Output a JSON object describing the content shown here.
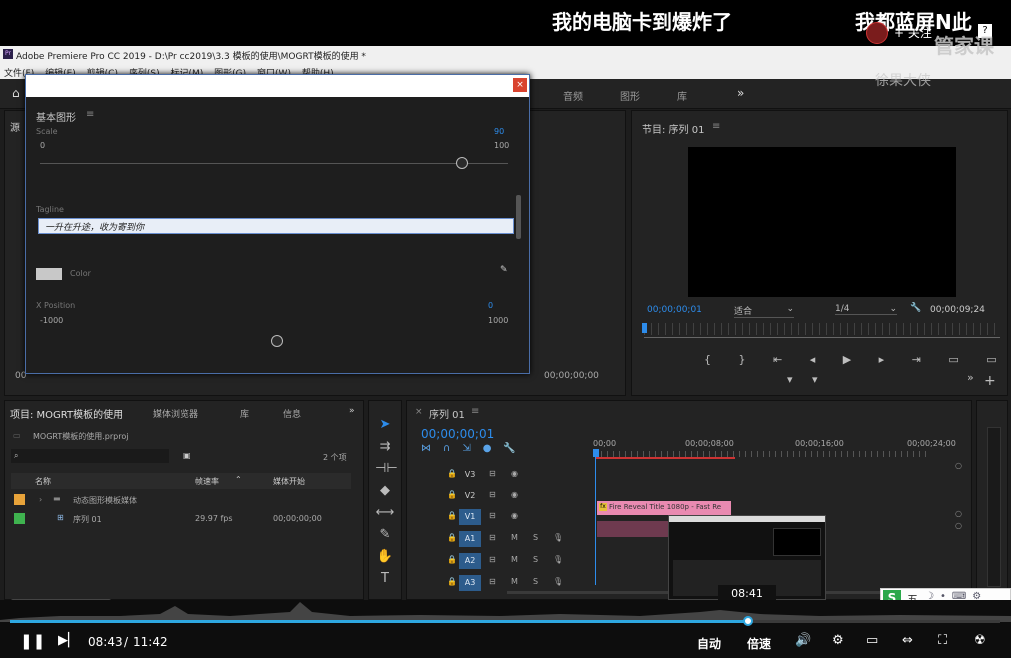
{
  "danmaku": [
    {
      "text": "我的电脑卡到爆炸了"
    },
    {
      "text": "我都蓝屏N此"
    }
  ],
  "overlay": {
    "follow_label": "+ 关注",
    "channel_watermark": "管家课",
    "uploader_watermark": "徐果大侠"
  },
  "premiere": {
    "title": "Adobe Premiere Pro CC 2019 - D:\\Pr cc2019\\3.3 模板的使用\\MOGRT模板的使用 *",
    "menu": [
      "文件(F)",
      "编辑(E)",
      "剪辑(C)",
      "序列(S)",
      "标记(M)",
      "图形(G)",
      "窗口(W)",
      "帮助(H)"
    ],
    "workspace_tabs": [
      "音频",
      "图形",
      "库"
    ],
    "workspace_more": "»"
  },
  "essential_graphics": {
    "title": "基本图形",
    "scale": {
      "label": "Scale",
      "min": "0",
      "max": "100",
      "value": "90"
    },
    "tagline": {
      "label": "Tagline",
      "value": "一升在升途，收为寄到你"
    },
    "color": {
      "label": "Color",
      "swatch": "#c8c8c8"
    },
    "xpos": {
      "label": "X Position",
      "min": "-1000",
      "max": "1000",
      "value": "0"
    }
  },
  "source_monitor": {
    "tab": "源",
    "timecode_left": "00",
    "timecode_right": "00;00;00;00"
  },
  "program_monitor": {
    "title": "节目: 序列 01",
    "timecode": "00;00;00;01",
    "fit": "适合",
    "resolution": "1/4",
    "duration": "00;00;09;24"
  },
  "project_panel": {
    "tabs": [
      "项目: MOGRT模板的使用",
      "媒体浏览器",
      "库",
      "信息"
    ],
    "file": "MOGRT模板的使用.prproj",
    "item_count": "2 个项",
    "columns": [
      "名称",
      "帧速率",
      "媒体开始"
    ],
    "rows": [
      {
        "color": "#e8a33a",
        "name": "动态图形模板媒体",
        "fps": "",
        "start": ""
      },
      {
        "color": "#3fb34f",
        "name": "序列 01",
        "fps": "29.97 fps",
        "start": "00;00;00;00"
      }
    ]
  },
  "timeline": {
    "tab": "序列 01",
    "timecode": "00;00;00;01",
    "ruler": [
      "00;00",
      "00;00;08;00",
      "00;00;16;00",
      "00;00;24;00"
    ],
    "tracks": [
      {
        "name": "V3",
        "active": false,
        "type": "video"
      },
      {
        "name": "V2",
        "active": false,
        "type": "video"
      },
      {
        "name": "V1",
        "active": true,
        "type": "video"
      },
      {
        "name": "A1",
        "active": true,
        "type": "audio"
      },
      {
        "name": "A2",
        "active": true,
        "type": "audio"
      },
      {
        "name": "A3",
        "active": true,
        "type": "audio"
      }
    ],
    "clip_label": "Fire Reveal Title 1080p - Fast Re"
  },
  "player": {
    "current_time": "08:43",
    "separator": "/",
    "total_time": "11:42",
    "progress": 0.745,
    "hover_time": "08:41",
    "quality": "自动",
    "speed": "倍速"
  },
  "ime": {
    "label": "五"
  }
}
